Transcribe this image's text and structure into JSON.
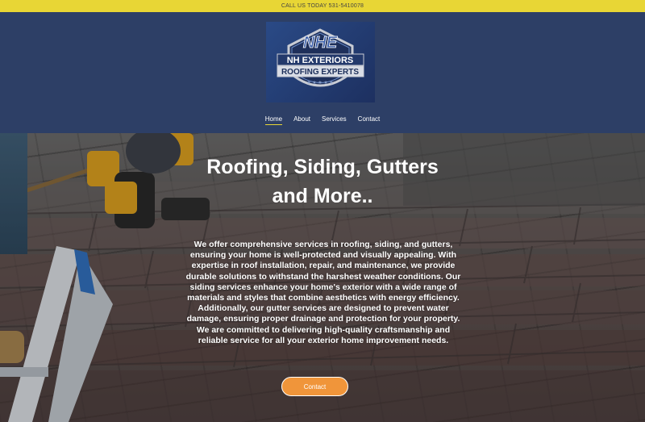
{
  "topbar": {
    "text": "CALL US TODAY 531-5410078"
  },
  "logo": {
    "line1": "NH EXTERIORS",
    "line2": "ROOFING EXPERTS",
    "monogram": "NHE"
  },
  "nav": {
    "items": [
      {
        "label": "Home",
        "active": true
      },
      {
        "label": "About",
        "active": false
      },
      {
        "label": "Services",
        "active": false
      },
      {
        "label": "Contact",
        "active": false
      }
    ]
  },
  "hero": {
    "title_line1": "Roofing, Siding, Gutters",
    "title_line2": "and More..",
    "body": "We offer comprehensive services in roofing, siding, and gutters, ensuring your home is well-protected and visually appealing. With expertise in roof installation, repair, and maintenance, we provide durable solutions to withstand the harshest weather conditions. Our siding services enhance your home's exterior with a wide range of materials and styles that combine aesthetics with energy efficiency. Additionally, our gutter services are designed to prevent water damage, ensuring proper drainage and protection for your property. We are committed to delivering high-quality craftsmanship and reliable service for all your exterior home improvement needs.",
    "cta_label": "Contact"
  },
  "colors": {
    "topbar": "#e8d635",
    "header": "#2d3f66",
    "cta": "#f0953a",
    "nav_active_underline": "#e8d635"
  }
}
